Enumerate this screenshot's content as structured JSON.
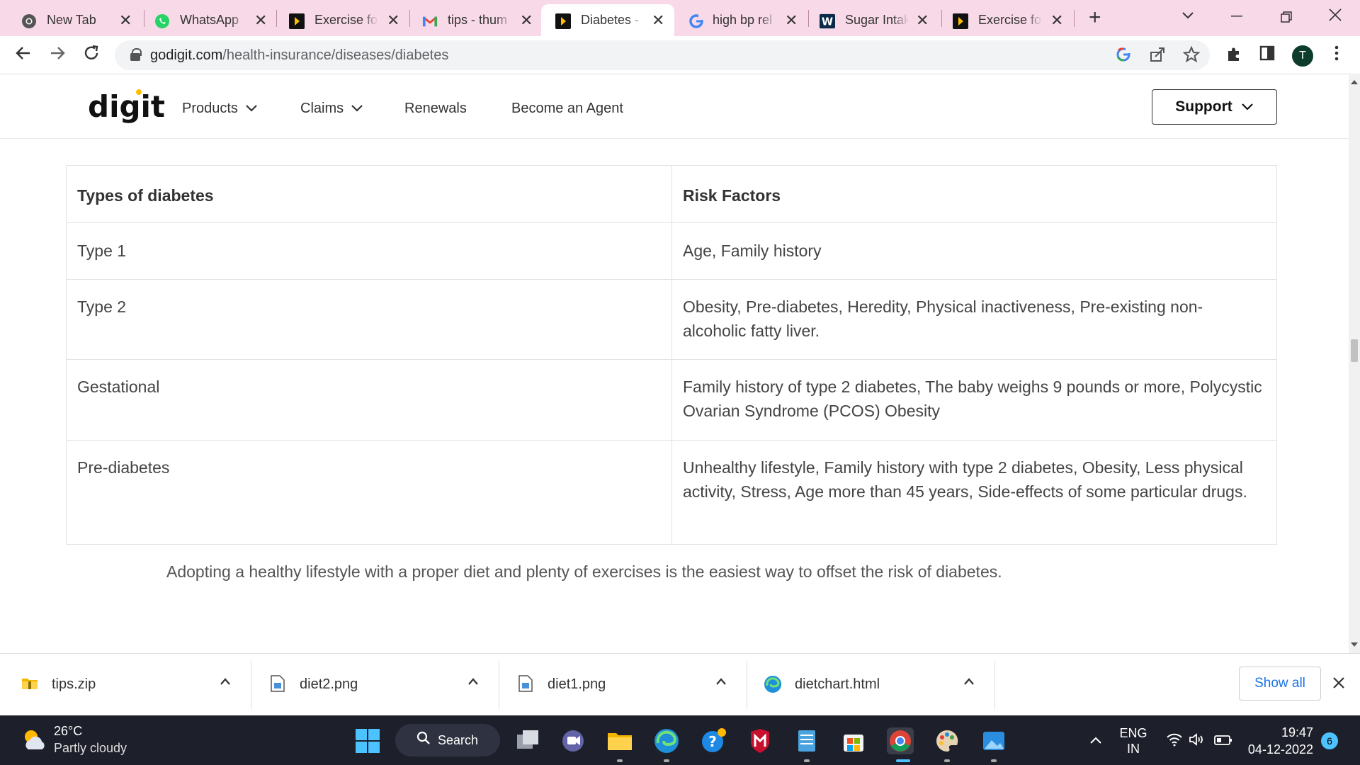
{
  "browser": {
    "tabs": [
      {
        "title": "New Tab",
        "icon": "chrome-icon"
      },
      {
        "title": "WhatsApp",
        "icon": "whatsapp-icon"
      },
      {
        "title": "Exercise for",
        "icon": "digit-icon"
      },
      {
        "title": "tips - thum",
        "icon": "gmail-icon"
      },
      {
        "title": "Diabetes - ",
        "icon": "digit-icon"
      },
      {
        "title": "high bp rel",
        "icon": "google-icon"
      },
      {
        "title": "Sugar Intak",
        "icon": "w-icon"
      },
      {
        "title": "Exercise for",
        "icon": "digit-icon"
      }
    ],
    "active_tab_index": 4,
    "url_domain": "godigit.com",
    "url_path": "/health-insurance/diseases/diabetes",
    "profile_initial": "T",
    "tab_close_glyph": "✕",
    "new_tab_glyph": "+"
  },
  "site": {
    "logo": "digit",
    "nav": [
      {
        "label": "Products",
        "dropdown": true
      },
      {
        "label": "Claims",
        "dropdown": true
      },
      {
        "label": "Renewals",
        "dropdown": false
      },
      {
        "label": "Become an Agent",
        "dropdown": false
      }
    ],
    "support_label": "Support"
  },
  "table": {
    "headers": [
      "Types of diabetes",
      "Risk Factors"
    ],
    "rows": [
      [
        "Type 1",
        "Age, Family history"
      ],
      [
        "Type 2",
        "Obesity, Pre-diabetes, Heredity, Physical inactiveness, Pre-existing non-alcoholic fatty liver."
      ],
      [
        "Gestational",
        "Family history of type 2 diabetes, The baby weighs 9 pounds or more, Polycystic Ovarian Syndrome (PCOS) Obesity"
      ],
      [
        "Pre-diabetes",
        "Unhealthy lifestyle, Family history with type 2 diabetes, Obesity, Less physical activity, Stress, Age more than 45 years, Side-effects of some particular drugs."
      ]
    ]
  },
  "paragraph": "Adopting a healthy lifestyle with a proper diet and plenty of exercises is the easiest way to offset the risk of diabetes.",
  "downloads": {
    "items": [
      {
        "name": "tips.zip",
        "icon": "zip-file-icon"
      },
      {
        "name": "diet2.png",
        "icon": "image-file-icon"
      },
      {
        "name": "diet1.png",
        "icon": "image-file-icon"
      },
      {
        "name": "dietchart.html",
        "icon": "edge-icon"
      }
    ],
    "show_all_label": "Show all"
  },
  "taskbar": {
    "temperature": "26°C",
    "condition": "Partly cloudy",
    "search_label": "Search",
    "lang_top": "ENG",
    "lang_bottom": "IN",
    "time": "19:47",
    "date": "04-12-2022",
    "notifications": "6"
  },
  "colors": {
    "tabstrip": "#f8d9e7",
    "accent_blue": "#1a73e8",
    "taskbar": "#1d1f2a",
    "logo_dot": "#ffbf00"
  }
}
